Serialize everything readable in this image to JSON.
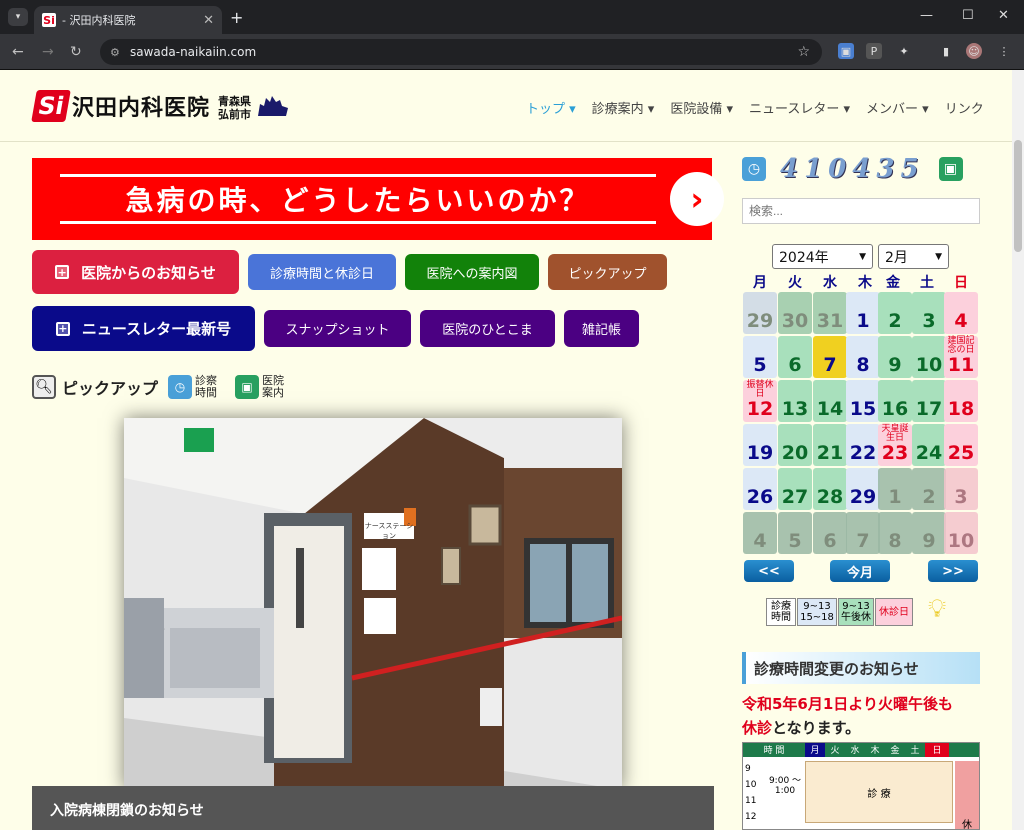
{
  "browser": {
    "tab_title": "- 沢田内科医院",
    "url": "sawada-naikaiin.com",
    "favicon_text": "Si"
  },
  "header": {
    "logo_mark": "Si",
    "logo_name": "沢田内科医院",
    "pref": "青森県",
    "city": "弘前市",
    "nav": [
      "トップ ▾",
      "診療案内 ▾",
      "医院設備 ▾",
      "ニュースレター ▾",
      "メンバー ▾",
      "リンク"
    ]
  },
  "banner": {
    "text": "急病の時、どうしたらいいのか？",
    "arrow": "›"
  },
  "buttons": {
    "notice": "医院からのお知らせ",
    "hours": "診療時間と休診日",
    "map": "医院への案内図",
    "pickup": "ピックアップ",
    "newsletter": "ニュースレター最新号",
    "snapshot": "スナップショット",
    "hitokoma": "医院のひとこま",
    "notes": "雑記帳"
  },
  "pickrow": {
    "pickup": "ピックアップ",
    "hours": "診察時間",
    "guide": "医院案内"
  },
  "photo": {
    "sign": "ナースステーション"
  },
  "caption": "入院病棟閉鎖のお知らせ",
  "sidebar": {
    "counter": "410435",
    "search_placeholder": "検索...",
    "year": "2024年",
    "month": "2月",
    "weekdays": [
      "月",
      "火",
      "水",
      "木",
      "金",
      "土",
      "日"
    ],
    "prev": "<<",
    "today": "今月",
    "next": ">>",
    "legend": {
      "l1": "診療時間",
      "l2": "9~13 15~18",
      "l3": "9~13 午後休",
      "l4": "休診日"
    },
    "notice_title": "診療時間変更のお知らせ",
    "notice_red": "令和5年6月1日より火曜午後も",
    "notice_red2": "休診",
    "notice_black": "となります。",
    "sched_header": [
      "時 間",
      "月",
      "火",
      "水",
      "木",
      "金",
      "土",
      "日"
    ],
    "sched_hours": [
      "9",
      "10",
      "11",
      "12"
    ],
    "sched_time": "9:00 〜 1:00",
    "sched_label": "診 療",
    "sched_sun": "休"
  },
  "calendar_days": [
    {
      "d": "29",
      "t": "o"
    },
    {
      "d": "30",
      "t": "o"
    },
    {
      "d": "31",
      "t": "o"
    },
    {
      "d": "1",
      "t": "b"
    },
    {
      "d": "2",
      "t": "g"
    },
    {
      "d": "3",
      "t": "g"
    },
    {
      "d": "4",
      "t": "r"
    },
    {
      "d": "5",
      "t": "b"
    },
    {
      "d": "6",
      "t": "g"
    },
    {
      "d": "7",
      "t": "y"
    },
    {
      "d": "8",
      "t": "b"
    },
    {
      "d": "9",
      "t": "g"
    },
    {
      "d": "10",
      "t": "g"
    },
    {
      "d": "11",
      "t": "r",
      "n": "建国記念の日"
    },
    {
      "d": "12",
      "t": "r",
      "n": "振替休日"
    },
    {
      "d": "13",
      "t": "g"
    },
    {
      "d": "14",
      "t": "g"
    },
    {
      "d": "15",
      "t": "b"
    },
    {
      "d": "16",
      "t": "g"
    },
    {
      "d": "17",
      "t": "g"
    },
    {
      "d": "18",
      "t": "r"
    },
    {
      "d": "19",
      "t": "b"
    },
    {
      "d": "20",
      "t": "g"
    },
    {
      "d": "21",
      "t": "g"
    },
    {
      "d": "22",
      "t": "b"
    },
    {
      "d": "23",
      "t": "r",
      "n": "天皇誕生日"
    },
    {
      "d": "24",
      "t": "g"
    },
    {
      "d": "25",
      "t": "r"
    },
    {
      "d": "26",
      "t": "b"
    },
    {
      "d": "27",
      "t": "g"
    },
    {
      "d": "28",
      "t": "g"
    },
    {
      "d": "29",
      "t": "b"
    },
    {
      "d": "1",
      "t": "o"
    },
    {
      "d": "2",
      "t": "o"
    },
    {
      "d": "3",
      "t": "or"
    },
    {
      "d": "4",
      "t": "o"
    },
    {
      "d": "5",
      "t": "o"
    },
    {
      "d": "6",
      "t": "o"
    },
    {
      "d": "7",
      "t": "o"
    },
    {
      "d": "8",
      "t": "o"
    },
    {
      "d": "9",
      "t": "o"
    },
    {
      "d": "10",
      "t": "or"
    }
  ],
  "colors": {
    "accent": "#2a9fd6",
    "red": "#ff0000",
    "navy": "#0a0a8a",
    "purple": "#4b0082"
  }
}
